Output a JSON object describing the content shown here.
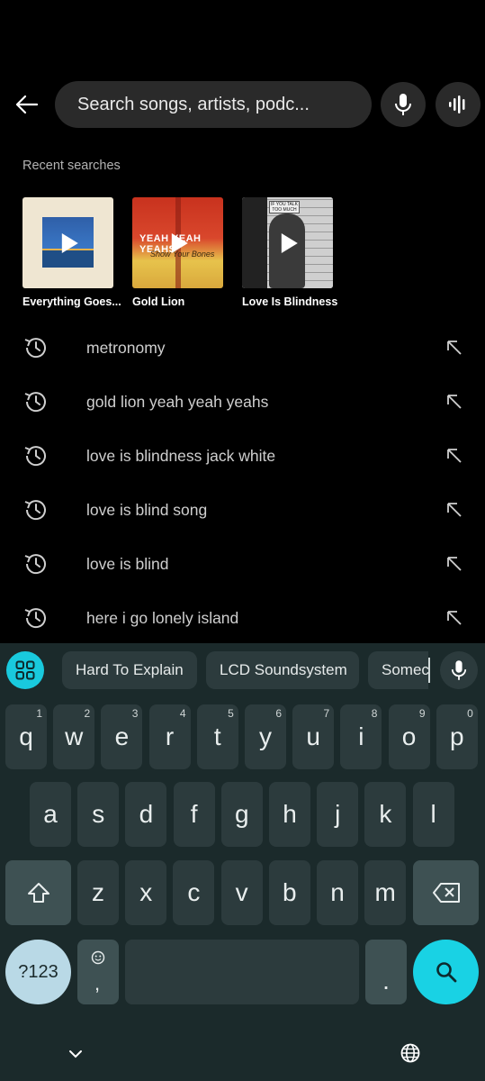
{
  "search": {
    "placeholder": "Search songs, artists, podc..."
  },
  "icons": {
    "back": "arrow-left-icon",
    "mic": "mic-icon",
    "recognize": "sound-wave-icon",
    "history": "history-icon",
    "fill_arrow": "arrow-up-left-icon"
  },
  "recent": {
    "title": "Recent searches",
    "cards": [
      {
        "label": "Everything Goes..."
      },
      {
        "label": "Gold Lion",
        "cover_text_1": "YEAH YEAH YEAHS",
        "cover_text_2": "Show Your Bones"
      },
      {
        "label": "Love Is Blindness",
        "cover_sign": "IF YOU TALK TOO MUCH"
      }
    ]
  },
  "history": [
    "metronomy",
    "gold lion yeah yeah yeahs",
    "love is blindness jack white",
    "love is blind song",
    "love is blind",
    "here i go lonely island"
  ],
  "keyboard": {
    "suggestions": [
      "Hard To Explain",
      "LCD Soundsystem",
      "Somec"
    ],
    "row1": [
      {
        "k": "q",
        "n": "1"
      },
      {
        "k": "w",
        "n": "2"
      },
      {
        "k": "e",
        "n": "3"
      },
      {
        "k": "r",
        "n": "4"
      },
      {
        "k": "t",
        "n": "5"
      },
      {
        "k": "y",
        "n": "6"
      },
      {
        "k": "u",
        "n": "7"
      },
      {
        "k": "i",
        "n": "8"
      },
      {
        "k": "o",
        "n": "9"
      },
      {
        "k": "p",
        "n": "0"
      }
    ],
    "row2": [
      "a",
      "s",
      "d",
      "f",
      "g",
      "h",
      "j",
      "k",
      "l"
    ],
    "row3": [
      "z",
      "x",
      "c",
      "v",
      "b",
      "n",
      "m"
    ],
    "sym_label": "?123",
    "comma": ",",
    "period": "."
  },
  "colors": {
    "accent": "#19d2e4",
    "background": "#000000",
    "keyboard_bg": "#1b2a2b"
  }
}
